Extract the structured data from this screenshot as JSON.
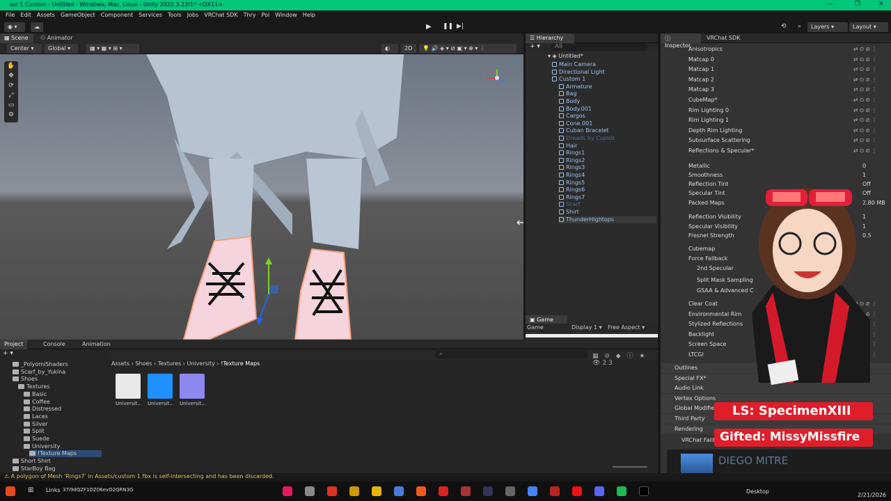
{
  "window": {
    "title": "avi 1 Custom - Untitled - Windows, Mac, Linux - Unity 2022.3.22f1* <DX11>",
    "min": "—",
    "max": "❐",
    "close": "✕"
  },
  "menu": [
    "File",
    "Edit",
    "Assets",
    "GameObject",
    "Component",
    "Services",
    "Tools",
    "Jobs",
    "VRChat SDK",
    "Thry",
    "Poi",
    "Window",
    "Help"
  ],
  "toolbar": {
    "layers": "Layers",
    "layout": "Layout"
  },
  "scene": {
    "tab": "Scene",
    "tab2": "Animator",
    "pivot": "Center",
    "space": "Global",
    "mode_2d": "2D"
  },
  "hierarchy": {
    "tab": "Hierarchy",
    "search": "All",
    "root": "Untitled*",
    "items": [
      {
        "label": "Main Camera",
        "dim": false
      },
      {
        "label": "Directional Light",
        "dim": false
      },
      {
        "label": "Custom 1",
        "dim": false
      },
      {
        "label": "Armature",
        "dim": false
      },
      {
        "label": "Bag",
        "dim": false
      },
      {
        "label": "Body",
        "dim": false
      },
      {
        "label": "Body.001",
        "dim": false
      },
      {
        "label": "Cargos",
        "dim": false
      },
      {
        "label": "Cone.001",
        "dim": false
      },
      {
        "label": "Cuban Bracelet",
        "dim": false
      },
      {
        "label": "Dreads by Cupids",
        "dim": true
      },
      {
        "label": "Hair",
        "dim": false
      },
      {
        "label": "Rings1",
        "dim": false
      },
      {
        "label": "Rings2",
        "dim": false
      },
      {
        "label": "Rings3",
        "dim": false
      },
      {
        "label": "Rings4",
        "dim": false
      },
      {
        "label": "Rings5",
        "dim": false
      },
      {
        "label": "Rings6",
        "dim": false
      },
      {
        "label": "Rings7",
        "dim": false
      },
      {
        "label": "Scarf",
        "dim": true
      },
      {
        "label": "Shirt",
        "dim": false
      },
      {
        "label": "ThunderHightops",
        "dim": false
      }
    ]
  },
  "game": {
    "tab": "Game",
    "display": "Game",
    "display_num": "Display 1",
    "aspect": "Free Aspect"
  },
  "inspector": {
    "tab": "Inspector",
    "tab2": "VRChat SDK",
    "sections": [
      "Anisotropics",
      "Matcap 0",
      "Matcap 1",
      "Matcap 2",
      "Matcap 3",
      "CubeMap*",
      "Rim Lighting 0",
      "Rim Lighting 1",
      "Depth Rim Lighting",
      "Subsurface Scattering",
      "Reflections & Specular*"
    ],
    "props": [
      {
        "label": "Metallic",
        "value": "0"
      },
      {
        "label": "Smoothness",
        "value": "1"
      },
      {
        "label": "Reflection Tint",
        "value": "Off"
      },
      {
        "label": "Specular Tint",
        "value": "Off"
      },
      {
        "label": "Packed Maps",
        "value": "2.80 MB"
      },
      {
        "label": "Reflection Visibility",
        "value": "1"
      },
      {
        "label": "Specular Visibility",
        "value": "1"
      },
      {
        "label": "Fresnel Strength",
        "value": "0.5"
      },
      {
        "label": "Cubemap",
        "value": ""
      },
      {
        "label": "Force Fallback",
        "value": ""
      },
      {
        "label": "2nd Specular",
        "value": ""
      },
      {
        "label": "Split Mask Sampling",
        "value": ""
      },
      {
        "label": "GSAA & Advanced C",
        "value": ""
      }
    ],
    "sections2": [
      "Clear Coat",
      "Environmental Rim",
      "Stylized Reflections",
      "Backlight",
      "Screen Space",
      "LTCGI"
    ],
    "sections3": [
      "Outlines",
      "Special FX*",
      "Audio Link",
      "Vertex Options",
      "Global Modifiers",
      "Third Party",
      "Rendering"
    ],
    "fallback": "VRChat Fallb"
  },
  "project": {
    "tabs": [
      "Project",
      "Console",
      "Animation"
    ],
    "tree": [
      {
        "label": "_PolyomiShaders",
        "indent": 1
      },
      {
        "label": "Scarf_by_Yukina",
        "indent": 1
      },
      {
        "label": "Shoes",
        "indent": 1
      },
      {
        "label": "Textures",
        "indent": 2
      },
      {
        "label": "Basic",
        "indent": 3
      },
      {
        "label": "Coffee",
        "indent": 3
      },
      {
        "label": "Distressed",
        "indent": 3
      },
      {
        "label": "Laces",
        "indent": 3
      },
      {
        "label": "Silver",
        "indent": 3
      },
      {
        "label": "Split",
        "indent": 3
      },
      {
        "label": "Suede",
        "indent": 3
      },
      {
        "label": "University",
        "indent": 3
      },
      {
        "label": "!Texture Maps",
        "indent": 4
      },
      {
        "label": "Short Shirt",
        "indent": 1
      },
      {
        "label": "StarBoy Bag",
        "indent": 1
      }
    ],
    "breadcrumb": [
      "Assets",
      "Shoes",
      "Textures",
      "University",
      "!Texture Maps"
    ],
    "assets": [
      {
        "label": "Universit...",
        "color": "#e8e8e8"
      },
      {
        "label": "Universit...",
        "color": "#1e90ff"
      },
      {
        "label": "Universit...",
        "color": "#8f87f0"
      }
    ],
    "count": "23"
  },
  "status": "A polygon of Mesh 'Rings7' in Assets/custom 1.fbx is self-intersecting and has been discarded.",
  "taskbar": {
    "links": "Links",
    "code": "37i9dQZF1DZ06evO2QRN3G",
    "desktop": "Desktop",
    "date": "2/21/2026"
  },
  "overlay": {
    "ls": "LS: SpecimenXIII",
    "gifted": "Gifted: MissyMissfire",
    "song": "DIEGO MITRE"
  }
}
